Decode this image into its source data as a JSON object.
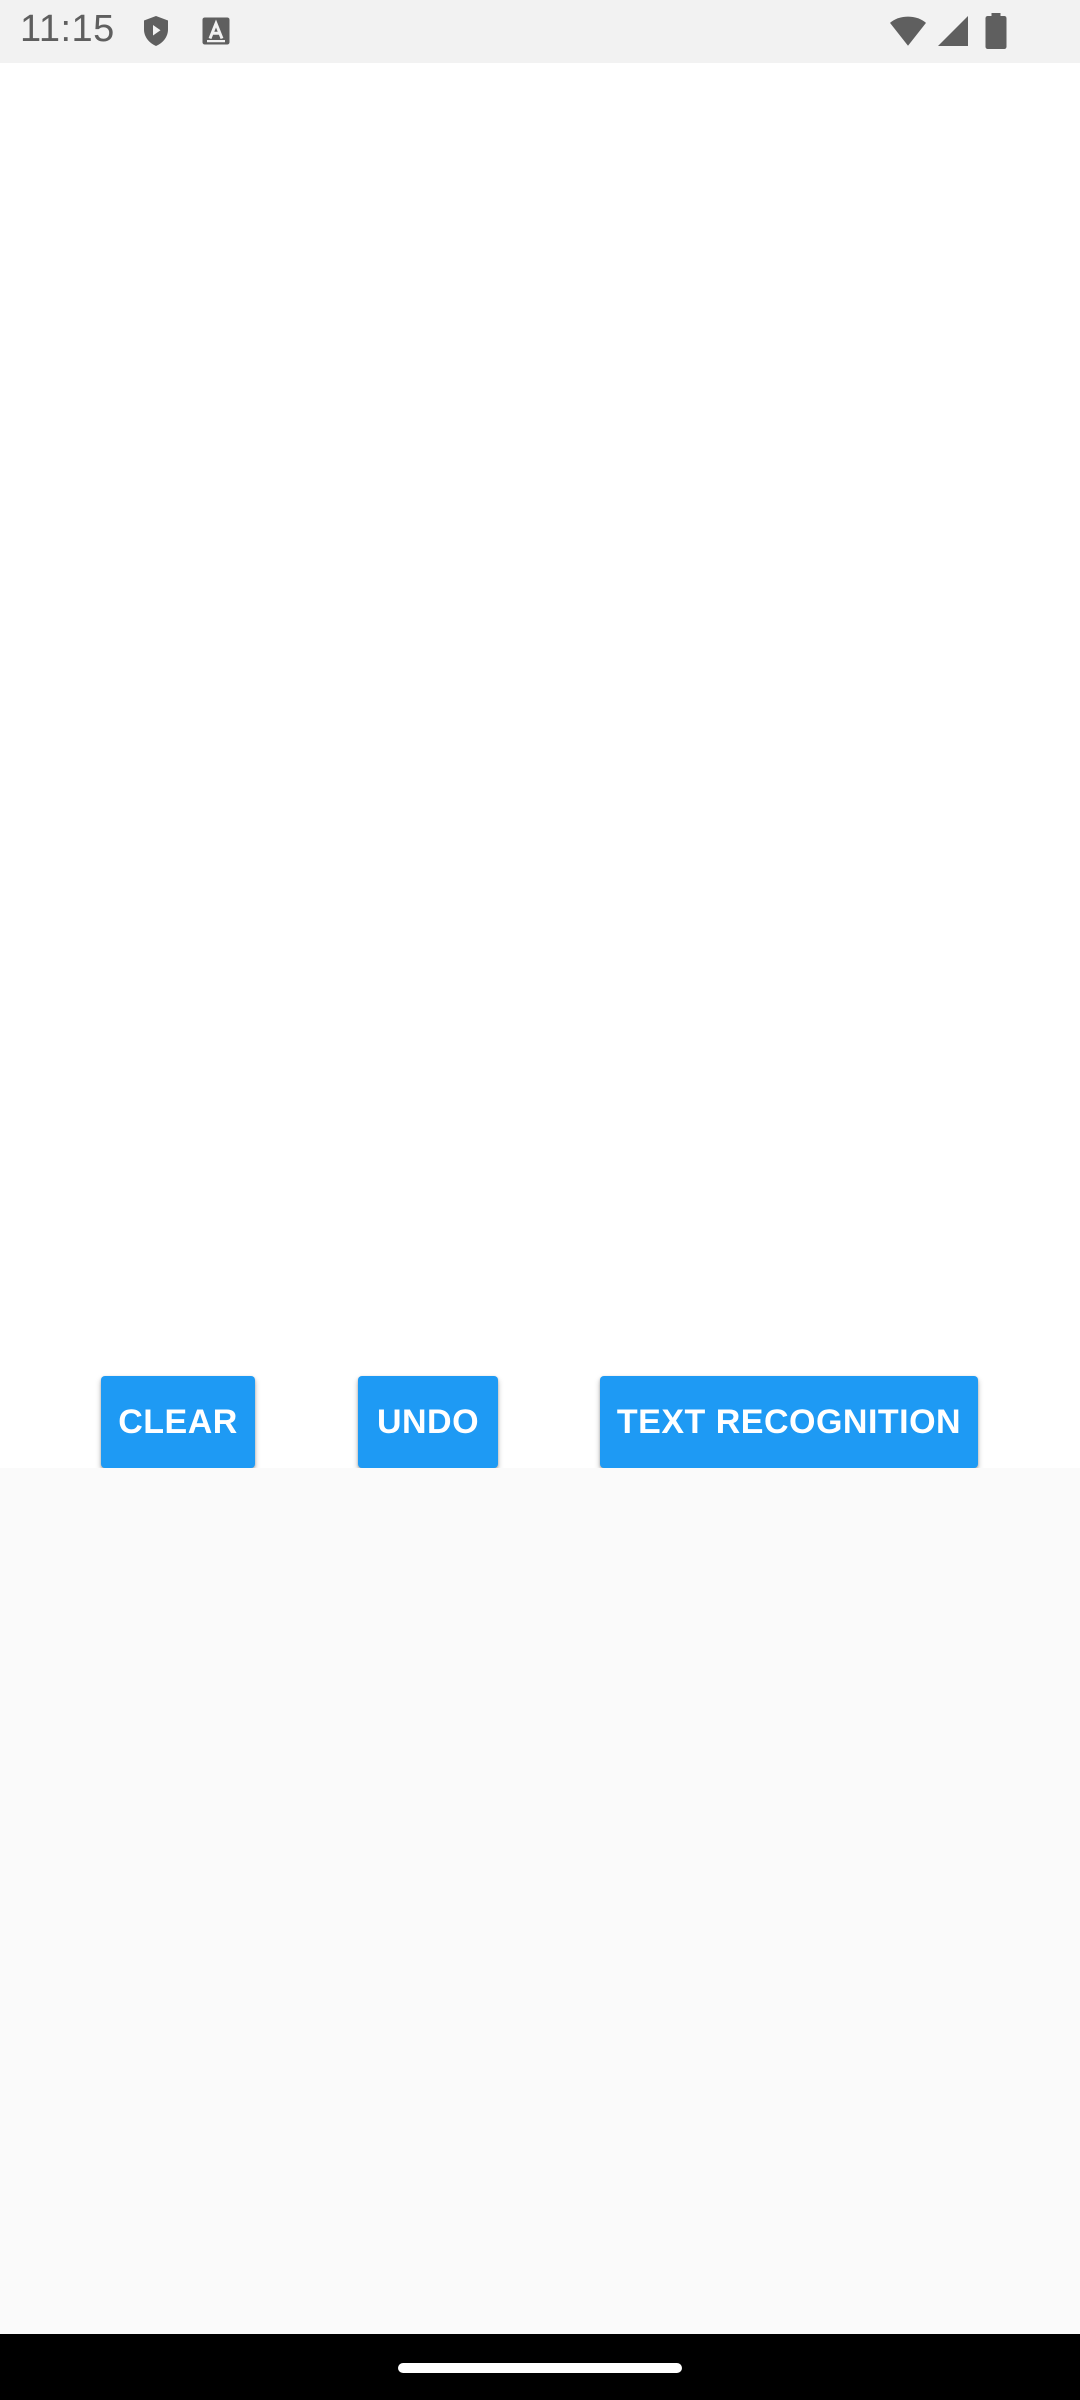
{
  "status_bar": {
    "time": "11:15",
    "icons": [
      "shield-play-icon",
      "font-a-icon",
      "wifi-icon",
      "cell-signal-icon",
      "battery-icon"
    ]
  },
  "buttons": {
    "clear_label": "CLEAR",
    "undo_label": "UNDO",
    "recognize_label": "TEXT RECOGNITION"
  },
  "colors": {
    "accent": "#1e9af4",
    "canvas": "#ffffff",
    "background": "#fafafa",
    "status_bar": "#f2f2f2",
    "nav_bar": "#000000"
  }
}
